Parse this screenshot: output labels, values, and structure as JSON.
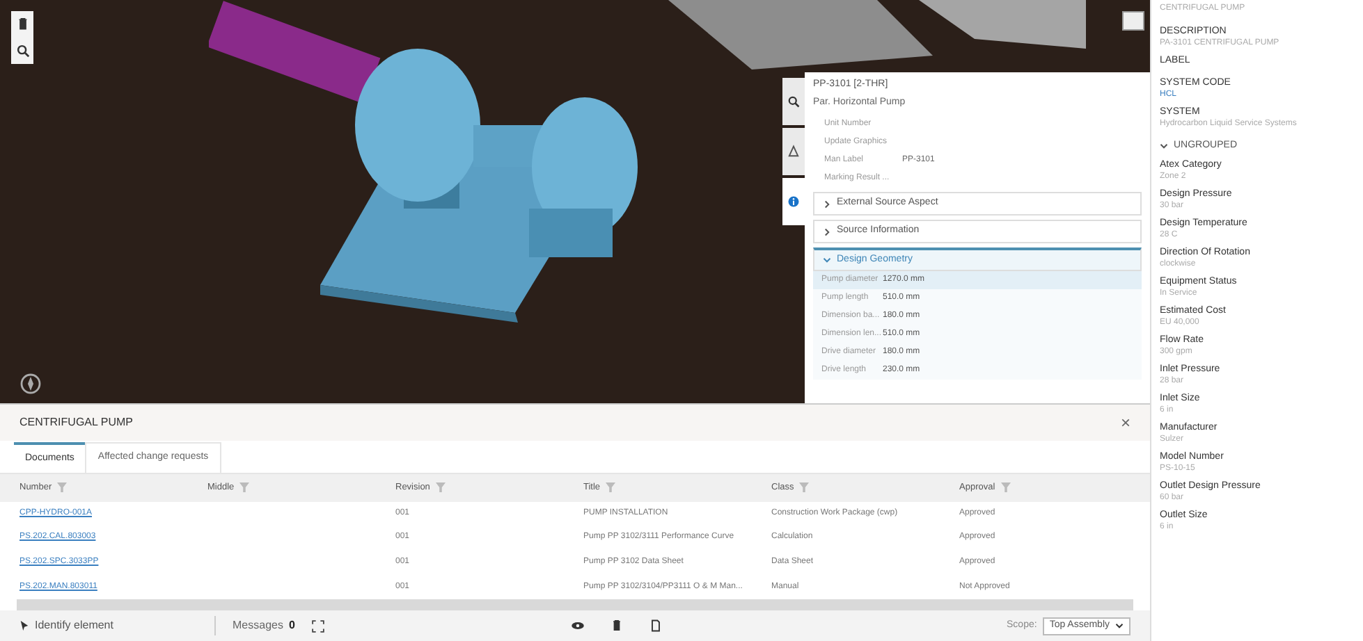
{
  "properties_popup": {
    "side_tabs": [
      {
        "selected": false
      },
      {
        "selected": false
      },
      {
        "selected": true
      }
    ],
    "title": "PP-3101 [2-THR]",
    "subtitle": "Par. Horizontal Pump",
    "fields": [
      {
        "label": "Unit Number"
      },
      {
        "label": "Update Graphics"
      },
      {
        "label": "Man Label",
        "value": "PP-3101"
      },
      {
        "label": "Marking Result ..."
      }
    ],
    "sections": [
      {
        "title": "External Source Aspect",
        "expanded": false
      },
      {
        "title": "Source Information",
        "expanded": false
      },
      {
        "title": "Design Geometry",
        "expanded": true,
        "rows": [
          {
            "label": "Pump diameter",
            "value": "1270.0 mm",
            "selected": true
          },
          {
            "label": "Pump length",
            "value": "510.0 mm",
            "selected": false
          },
          {
            "label": "Dimension ba...",
            "value": "180.0 mm",
            "selected": false
          },
          {
            "label": "Dimension len...",
            "value": "510.0 mm",
            "selected": false
          },
          {
            "label": "Drive diameter",
            "value": "180.0 mm",
            "selected": false
          },
          {
            "label": "Drive length",
            "value": "230.0 mm",
            "selected": false
          }
        ]
      }
    ]
  },
  "bottom_panel": {
    "title": "CENTRIFUGAL PUMP",
    "close": "×",
    "tabs": [
      {
        "label": "Documents",
        "selected": true
      },
      {
        "label": "Affected change requests",
        "selected": false
      }
    ],
    "table": {
      "columns": [
        "Number",
        "Middle",
        "Revision",
        "Title",
        "Class",
        "Approval"
      ],
      "rows": [
        [
          "CPP-HYDRO-001A",
          null,
          "001",
          "PUMP INSTALLATION",
          "Construction Work Package (cwp)",
          "Approved"
        ],
        [
          "PS.202.CAL.803003",
          null,
          "001",
          "Pump PP 3102/3111 Performance Curve",
          "Calculation",
          "Approved"
        ],
        [
          "PS.202.SPC.3033PP",
          null,
          "001",
          "Pump PP 3102 Data Sheet",
          "Data Sheet",
          "Approved"
        ],
        [
          "PS.202.MAN.803011",
          null,
          "001",
          "Pump PP 3102/3104/PP3111 O & M Man...",
          "Manual",
          "Not Approved"
        ]
      ]
    }
  },
  "status_bar": {
    "identify": "Identify element",
    "messages_label": "Messages",
    "messages_count": "0",
    "scope_label": "Scope:",
    "scope_value": "Top Assembly"
  },
  "attributes": {
    "items": [
      {
        "kind": "field",
        "value": "CENTRIFUGAL PUMP"
      },
      {
        "kind": "field",
        "label": "DESCRIPTION",
        "value": "PA-3101 CENTRIFUGAL PUMP"
      },
      {
        "kind": "field",
        "label": "LABEL"
      },
      {
        "kind": "field",
        "label": "SYSTEM CODE",
        "value": "HCL",
        "link": true
      },
      {
        "kind": "field",
        "label": "SYSTEM",
        "value": "Hydrocarbon Liquid Service Systems"
      },
      {
        "kind": "group",
        "label": "UNGROUPED",
        "expanded": true
      },
      {
        "kind": "field",
        "label": "Atex Category",
        "value": "Zone 2"
      },
      {
        "kind": "field",
        "label": "Design Pressure",
        "value": "30 bar"
      },
      {
        "kind": "field",
        "label": "Design Temperature",
        "value": "28 C"
      },
      {
        "kind": "field",
        "label": "Direction Of Rotation",
        "value": "clockwise"
      },
      {
        "kind": "field",
        "label": "Equipment Status",
        "value": "In Service"
      },
      {
        "kind": "field",
        "label": "Estimated Cost",
        "value": "EU 40,000"
      },
      {
        "kind": "field",
        "label": "Flow Rate",
        "value": "300 gpm"
      },
      {
        "kind": "field",
        "label": "Inlet Pressure",
        "value": "28 bar"
      },
      {
        "kind": "field",
        "label": "Inlet Size",
        "value": "6 in"
      },
      {
        "kind": "field",
        "label": "Manufacturer",
        "value": "Sulzer"
      },
      {
        "kind": "field",
        "label": "Model Number",
        "value": "PS-10-15"
      },
      {
        "kind": "field",
        "label": "Outlet Design Pressure",
        "value": "60 bar"
      },
      {
        "kind": "field",
        "label": "Outlet Size",
        "value": "6 in"
      }
    ]
  }
}
